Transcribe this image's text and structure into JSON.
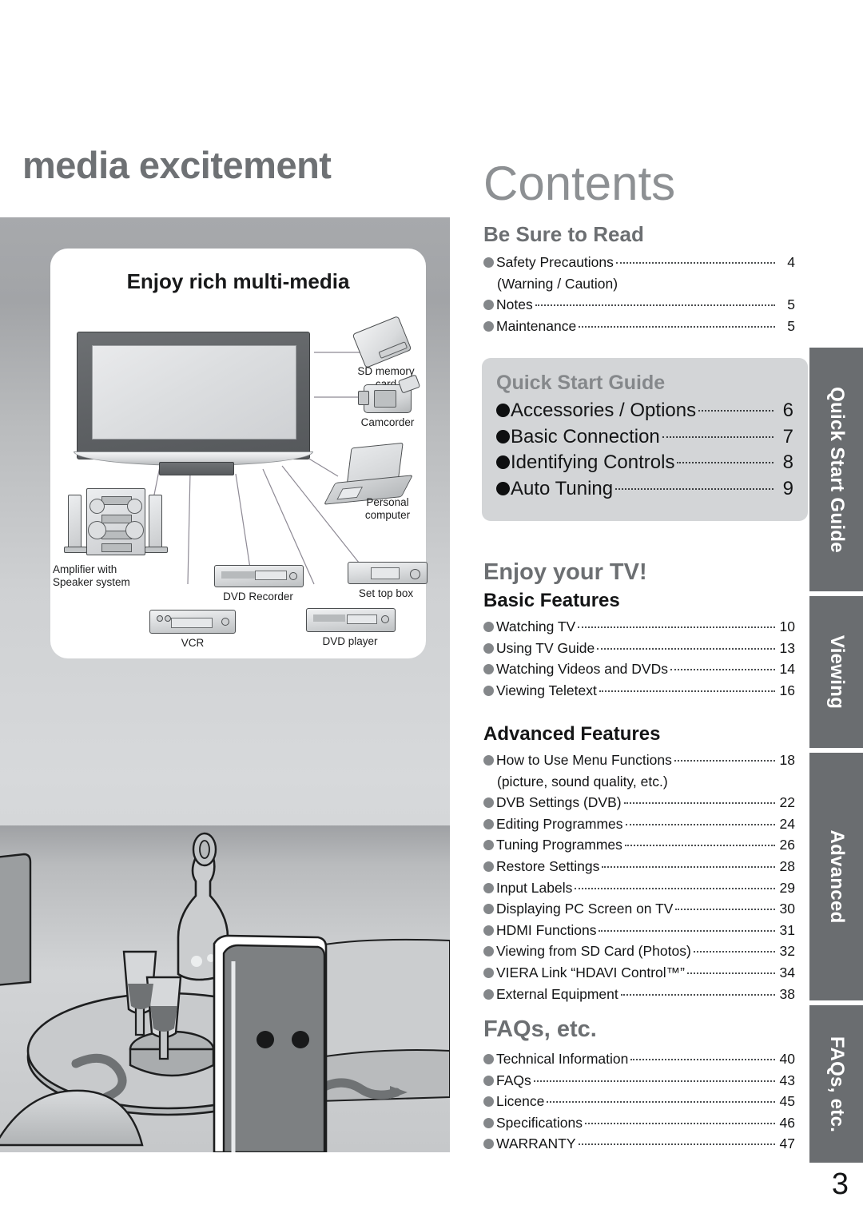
{
  "page": {
    "number": "3",
    "left_heading": "media excitement",
    "diagram_title": "Enjoy rich multi-media"
  },
  "diagram": {
    "devices": [
      {
        "name": "sd-memory-card",
        "label": "SD memory card"
      },
      {
        "name": "camcorder",
        "label": "Camcorder"
      },
      {
        "name": "personal-computer",
        "label": "Personal\ncomputer"
      },
      {
        "name": "amplifier-speaker-system",
        "label": "Amplifier with\nSpeaker system"
      },
      {
        "name": "dvd-recorder",
        "label": "DVD Recorder"
      },
      {
        "name": "set-top-box",
        "label": "Set top box"
      },
      {
        "name": "vcr",
        "label": "VCR"
      },
      {
        "name": "dvd-player",
        "label": "DVD player"
      }
    ]
  },
  "contents": {
    "title": "Contents",
    "sections": [
      {
        "id": "be-sure-to-read",
        "heading": "Be Sure to Read",
        "items": [
          {
            "label": "Safety Precautions",
            "page": "4"
          },
          {
            "label": "Notes",
            "page": "5"
          },
          {
            "label": "Maintenance",
            "page": "5"
          }
        ],
        "sub_note": "(Warning / Caution)"
      },
      {
        "id": "quick-start-guide",
        "heading": "Quick Start Guide",
        "items": [
          {
            "label": "Accessories / Options",
            "page": "6"
          },
          {
            "label": "Basic Connection",
            "page": "7"
          },
          {
            "label": "Identifying Controls",
            "page": "8"
          },
          {
            "label": "Auto Tuning",
            "page": "9"
          }
        ]
      },
      {
        "id": "enjoy-your-tv",
        "heading": "Enjoy your TV!",
        "subheading": "Basic Features",
        "items": [
          {
            "label": "Watching TV",
            "page": "10"
          },
          {
            "label": "Using TV Guide",
            "page": "13"
          },
          {
            "label": "Watching Videos and DVDs",
            "page": "14"
          },
          {
            "label": "Viewing Teletext",
            "page": "16"
          }
        ]
      },
      {
        "id": "advanced-features",
        "heading": "Advanced Features",
        "items": [
          {
            "label": "How to Use Menu Functions",
            "page": "18"
          },
          {
            "label": "DVB Settings (DVB)",
            "page": "22"
          },
          {
            "label": "Editing Programmes",
            "page": "24"
          },
          {
            "label": "Tuning Programmes",
            "page": "26"
          },
          {
            "label": "Restore Settings",
            "page": "28"
          },
          {
            "label": "Input Labels",
            "page": "29"
          },
          {
            "label": "Displaying PC Screen on TV",
            "page": "30"
          },
          {
            "label": "HDMI Functions",
            "page": "31"
          },
          {
            "label": "Viewing from SD Card (Photos)",
            "page": "32"
          },
          {
            "label": "VIERA Link “HDAVI Control™”",
            "page": "34"
          },
          {
            "label": "External Equipment",
            "page": "38"
          }
        ],
        "sub_note": "(picture, sound quality, etc.)"
      },
      {
        "id": "faqs-etc",
        "heading": "FAQs, etc.",
        "items": [
          {
            "label": "Technical Information",
            "page": "40"
          },
          {
            "label": "FAQs",
            "page": "43"
          },
          {
            "label": "Licence",
            "page": "45"
          },
          {
            "label": "Specifications",
            "page": "46"
          },
          {
            "label": "WARRANTY",
            "page": "47"
          }
        ]
      }
    ]
  },
  "side_tabs": [
    {
      "id": "quick-start-guide",
      "label": "Quick Start Guide"
    },
    {
      "id": "viewing",
      "label": "Viewing"
    },
    {
      "id": "advanced",
      "label": "Advanced"
    },
    {
      "id": "faqs-etc",
      "label": "FAQs, etc."
    }
  ],
  "colors": {
    "tab_gray": "#6a6d70",
    "panel_gray": "#bcbec0",
    "heading_gray": "#6e7174",
    "title_gray": "#8d9093",
    "bullet_gray": "#84878a",
    "qs_box": "#d3d5d7"
  }
}
